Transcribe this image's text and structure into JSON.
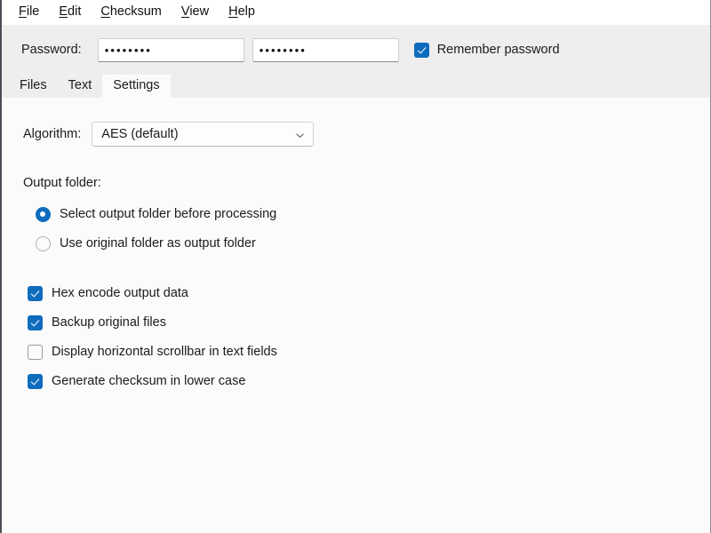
{
  "menubar": {
    "items": [
      {
        "label": "File",
        "mnemonic": "F",
        "rest": "ile"
      },
      {
        "label": "Edit",
        "mnemonic": "E",
        "rest": "dit"
      },
      {
        "label": "Checksum",
        "mnemonic": "C",
        "rest": "hecksum"
      },
      {
        "label": "View",
        "mnemonic": "V",
        "rest": "iew"
      },
      {
        "label": "Help",
        "mnemonic": "H",
        "rest": "elp"
      }
    ]
  },
  "password_bar": {
    "label": "Password:",
    "field1": {
      "value": "••••••••",
      "placeholder": ""
    },
    "field2": {
      "value": "••••••••",
      "placeholder": ""
    },
    "remember": {
      "label": "Remember password",
      "checked": true
    }
  },
  "tabs": {
    "items": [
      {
        "label": "Files",
        "active": false
      },
      {
        "label": "Text",
        "active": false
      },
      {
        "label": "Settings",
        "active": true
      }
    ]
  },
  "settings": {
    "algorithm": {
      "label": "Algorithm:",
      "selected": "AES (default)",
      "chevron_icon": "chevron-down-icon"
    },
    "output_folder": {
      "title": "Output folder:",
      "options": [
        {
          "label": "Select output folder before processing",
          "selected": true
        },
        {
          "label": "Use original folder as output folder",
          "selected": false
        }
      ]
    },
    "checkboxes": [
      {
        "label": "Hex encode output data",
        "checked": true
      },
      {
        "label": "Backup original files",
        "checked": true
      },
      {
        "label": "Display horizontal scrollbar in text fields",
        "checked": false
      },
      {
        "label": "Generate checksum in lower case",
        "checked": true
      }
    ]
  },
  "colors": {
    "accent": "#0f6cbd",
    "panel_bg": "#eeeeee",
    "content_bg": "#fbfbfb",
    "text": "#1b1b1b",
    "field_bg": "#ffffff"
  }
}
